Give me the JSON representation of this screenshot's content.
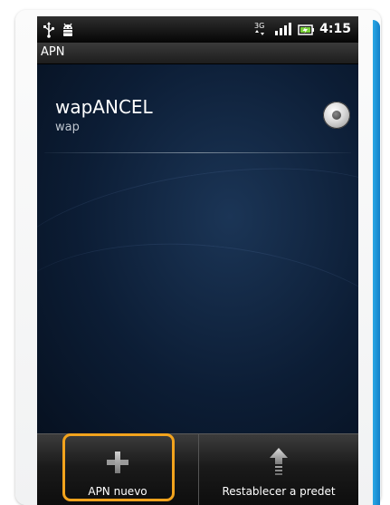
{
  "status_bar": {
    "time": "4:15",
    "network_label": "3G",
    "icons": [
      "usb-icon",
      "android-debug-icon",
      "network-3g-icon",
      "signal-icon",
      "battery-icon"
    ]
  },
  "title_bar": {
    "title": "APN"
  },
  "apn_list": [
    {
      "name": "wapANCEL",
      "type": "wap",
      "selected": false
    }
  ],
  "menu": {
    "buttons": [
      {
        "label": "APN nuevo",
        "icon": "plus-icon"
      },
      {
        "label": "Restablecer a predet",
        "icon": "reset-up-arrow-icon"
      }
    ]
  },
  "colors": {
    "highlight": "#f2a31d",
    "accent_edge": "#1380c8",
    "background": "#0a1526"
  }
}
